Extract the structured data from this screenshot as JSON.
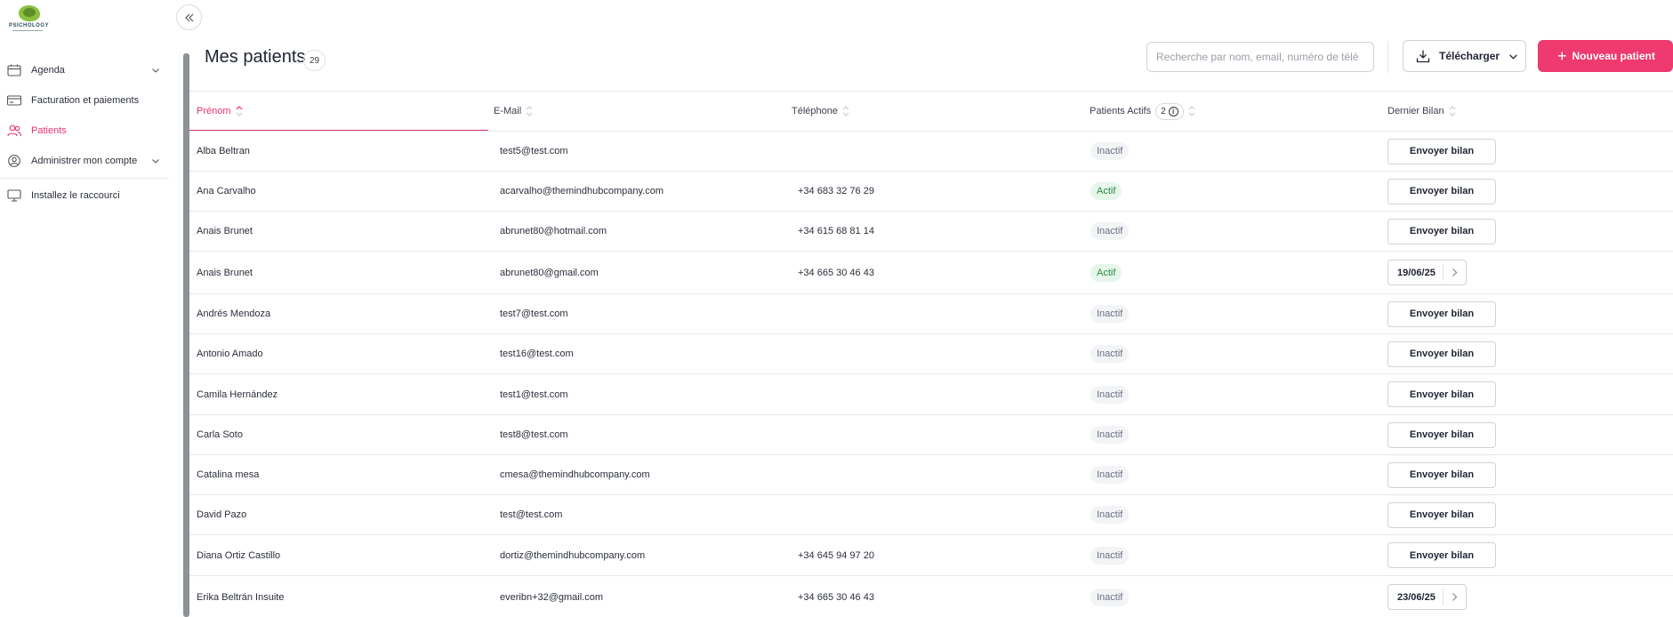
{
  "app": {
    "logo_text": "PSICHOLOGY"
  },
  "sidebar": {
    "items": [
      {
        "label": "Agenda",
        "icon": "calendar-icon",
        "has_chevron": true
      },
      {
        "label": "Facturation et paiements",
        "icon": "credit-card-icon",
        "has_chevron": false
      },
      {
        "label": "Patients",
        "icon": "users-icon",
        "has_chevron": false,
        "active": true
      },
      {
        "label": "Administrer mon compte",
        "icon": "user-circle-icon",
        "has_chevron": true
      },
      {
        "label": "Installez le raccourci",
        "icon": "monitor-icon",
        "has_chevron": false
      }
    ]
  },
  "header": {
    "title": "Mes patients",
    "count": "29",
    "search_placeholder": "Recherche par nom, email, numéro de télé",
    "download_label": "Télécharger",
    "new_patient_label": "Nouveau patient"
  },
  "table": {
    "columns": {
      "first_name": "Prénom",
      "email": "E-Mail",
      "phone": "Téléphone",
      "active": "Patients Actifs",
      "active_count": "2",
      "last": "Dernier Bilan"
    },
    "rows": [
      {
        "name": "Alba Beltran",
        "email": "test5@test.com",
        "phone": "",
        "status": "Inactif",
        "last": "",
        "action": "Envoyer bilan"
      },
      {
        "name": "Ana Carvalho",
        "email": "acarvalho@themindhubcompany.com",
        "phone": "+34 683 32 76 29",
        "status": "Actif",
        "last": "",
        "action": "Envoyer bilan"
      },
      {
        "name": "Anais Brunet",
        "email": "abrunet80@hotmail.com",
        "phone": "+34 615 68 81 14",
        "status": "Inactif",
        "last": "",
        "action": "Envoyer bilan"
      },
      {
        "name": "Anais Brunet",
        "email": "abrunet80@gmail.com",
        "phone": "+34 665 30 46 43",
        "status": "Actif",
        "last": "19/06/25",
        "action": ""
      },
      {
        "name": "Andrés Mendoza",
        "email": "test7@test.com",
        "phone": "",
        "status": "Inactif",
        "last": "",
        "action": "Envoyer bilan"
      },
      {
        "name": "Antonio Amado",
        "email": "test16@test.com",
        "phone": "",
        "status": "Inactif",
        "last": "",
        "action": "Envoyer bilan"
      },
      {
        "name": "Camila Hernández",
        "email": "test1@test.com",
        "phone": "",
        "status": "Inactif",
        "last": "",
        "action": "Envoyer bilan"
      },
      {
        "name": "Carla Soto",
        "email": "test8@test.com",
        "phone": "",
        "status": "Inactif",
        "last": "",
        "action": "Envoyer bilan"
      },
      {
        "name": "Catalina mesa",
        "email": "cmesa@themindhubcompany.com",
        "phone": "",
        "status": "Inactif",
        "last": "",
        "action": "Envoyer bilan"
      },
      {
        "name": "David Pazo",
        "email": "test@test.com",
        "phone": "",
        "status": "Inactif",
        "last": "",
        "action": "Envoyer bilan"
      },
      {
        "name": "Diana Ortiz Castillo",
        "email": "dortiz@themindhubcompany.com",
        "phone": "+34 645 94 97 20",
        "status": "Inactif",
        "last": "",
        "action": "Envoyer bilan"
      },
      {
        "name": "Erika Beltrán Insuite",
        "email": "everibn+32@gmail.com",
        "phone": "+34 665 30 46 43",
        "status": "Inactif",
        "last": "23/06/25",
        "action": ""
      }
    ]
  },
  "colors": {
    "accent": "#ee3a6e",
    "active_text": "#e8336b",
    "actif_bg": "#e6f6ea",
    "actif_text": "#2f8a45"
  }
}
